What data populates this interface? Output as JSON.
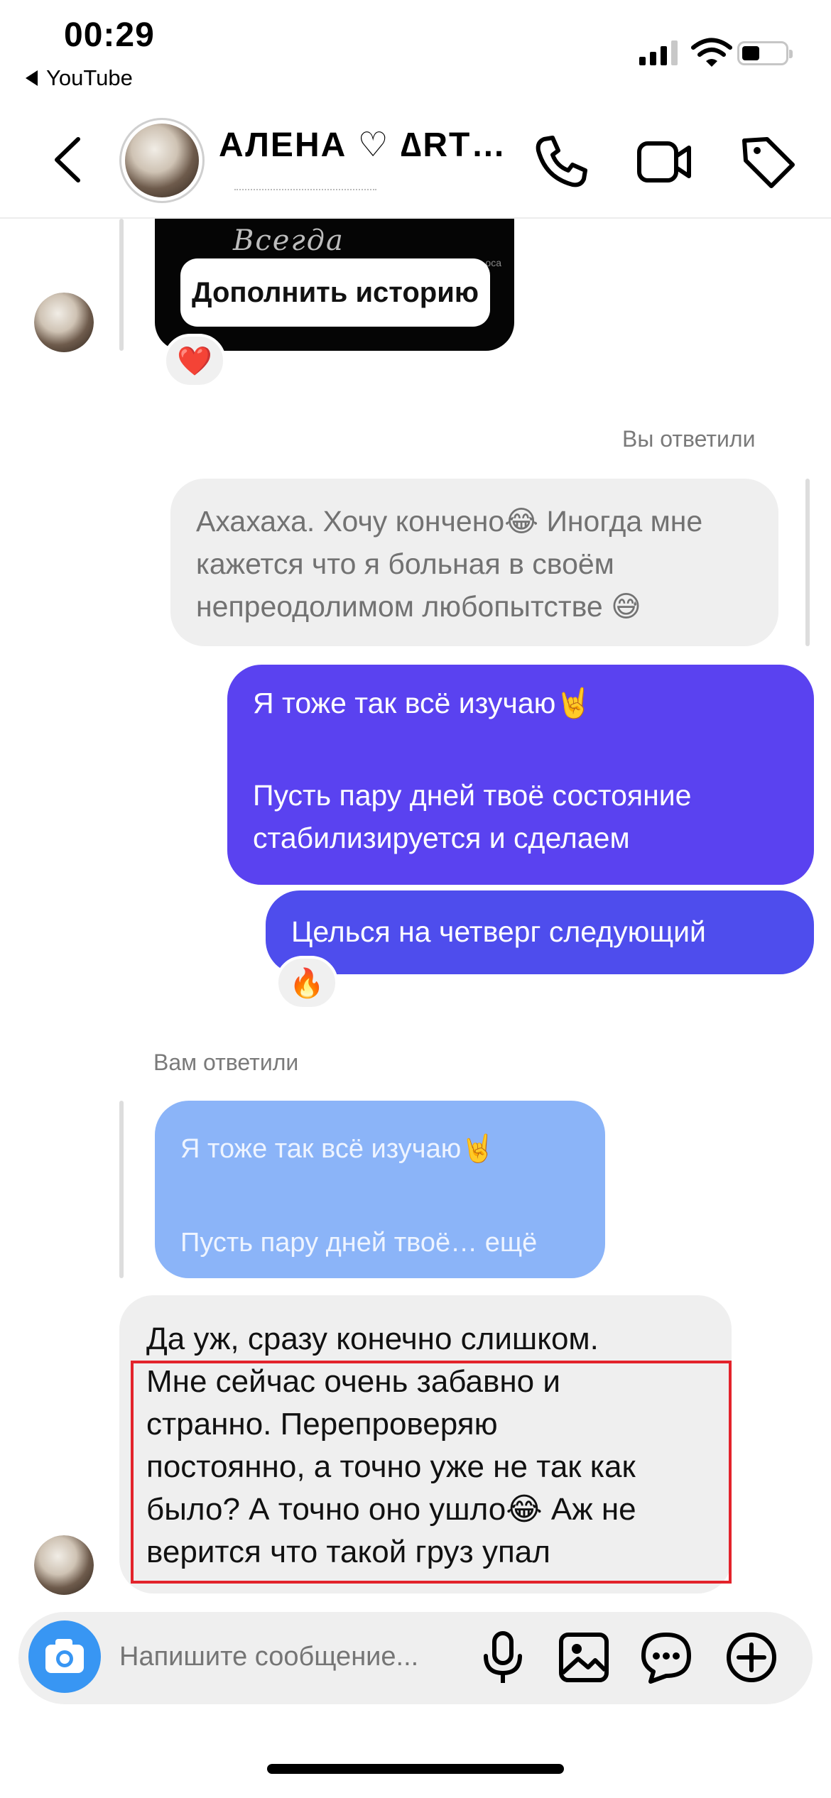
{
  "status": {
    "time": "00:29",
    "back_app": "YouTube"
  },
  "header": {
    "name": "АЛЕНА ♡  ∆RT…"
  },
  "story": {
    "script_text": "Всегда",
    "button_label": "Дополнить историю",
    "reaction": "❤️"
  },
  "messages": {
    "you_replied_label": "Вы ответили",
    "quote_lines": [
      "Ахахаха. Хочу кончено😂 Иногда мне",
      "кажется что я больная в своём",
      "непреодолимом любопытстве 😅"
    ],
    "sent1_line1": "Я тоже так всё изучаю🤘",
    "sent1_line2": "Пусть пару дней твоё состояние",
    "sent1_line3": "стабилизируется и сделаем",
    "sent2": "Целься на четверг следующий",
    "sent2_reaction": "🔥",
    "replied_to_you_label": "Вам ответили",
    "replied_quote_line1": "Я тоже так всё изучаю🤘",
    "replied_quote_line2": "Пусть пару дней твоё… ещё",
    "received_lines": [
      "Да уж, сразу конечно слишком.",
      "Мне сейчас очень забавно и",
      "странно. Перепроверяю",
      "постоянно, а точно уже не так как",
      "было? А точно оно ушло😂 Аж не",
      "верится что такой груз упал"
    ]
  },
  "composer": {
    "placeholder": "Напишите сообщение..."
  },
  "colors": {
    "sent_bubble": "#5a42f0",
    "sent_bubble_2": "#4e4ded",
    "quote_bubble": "#8bb4f8",
    "camera": "#3896f3",
    "highlight": "#e3232b"
  },
  "icons": [
    "back-arrow-icon",
    "phone-icon",
    "video-camera-icon",
    "tag-icon",
    "camera-icon",
    "microphone-icon",
    "image-icon",
    "sticker-chat-icon",
    "plus-icon"
  ]
}
